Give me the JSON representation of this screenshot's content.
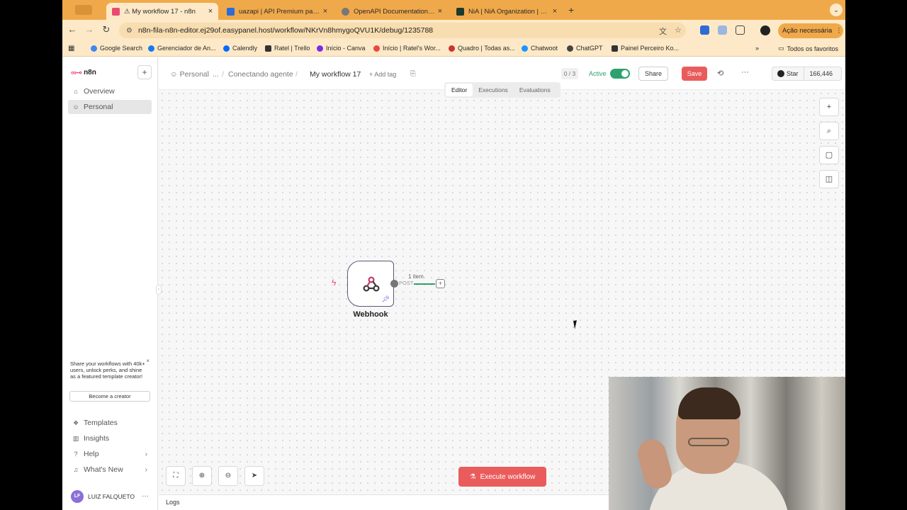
{
  "browser": {
    "tabs": [
      {
        "title": "⚠ My workflow 17 - n8n",
        "active": true
      },
      {
        "title": "uazapi | API Premium para W...",
        "active": false
      },
      {
        "title": "OpenAPI Documentation Gen...",
        "active": false
      },
      {
        "title": "NiA | NiA Organization | Supa...",
        "active": false
      }
    ],
    "new_tab": "+",
    "url": "n8n-fila-n8n-editor.ej29of.easypanel.host/workflow/NKrVn8hmygoQVU1K/debug/1235788",
    "update_button": "Ação necessária",
    "bookmarks": [
      "Google Search",
      "Gerenciador de An...",
      "Calendly",
      "Ratel | Trello",
      "Início - Canva",
      "Início | Ratel's Wor...",
      "Quadro | Todas as...",
      "Chatwoot",
      "ChatGPT",
      "Painel Perceiro Ko..."
    ],
    "all_bookmarks": "Todos os favoritos"
  },
  "sidebar": {
    "logo": "n8n",
    "items": [
      {
        "label": "Overview",
        "icon": "home-icon"
      },
      {
        "label": "Personal",
        "icon": "user-icon"
      }
    ],
    "promo": {
      "text": "Share your workflows with 40k+ users, unlock perks, and shine as a featured template creator!",
      "button": "Become a creator"
    },
    "bottom_items": [
      {
        "label": "Templates",
        "icon": "templates-icon"
      },
      {
        "label": "Insights",
        "icon": "insights-icon"
      },
      {
        "label": "Help",
        "icon": "help-icon"
      },
      {
        "label": "What's New",
        "icon": "bell-icon"
      }
    ],
    "user": {
      "initials": "LF",
      "name": "LUIZ FALQUETO"
    }
  },
  "header": {
    "breadcrumb": [
      "Personal",
      "...",
      "Conectando agente"
    ],
    "title": "My workflow 17",
    "add_tag": "+ Add tag",
    "counter": "0 / 3",
    "active_label": "Active",
    "share": "Share",
    "save": "Save",
    "github_star": "Star",
    "github_count": "166,446",
    "tabs": [
      "Editor",
      "Executions",
      "Evaluations"
    ]
  },
  "canvas": {
    "node": {
      "name": "Webhook"
    },
    "edge": {
      "items": "1 item",
      "method": "POST"
    },
    "execute_button": "Execute workflow",
    "logs": "Logs"
  },
  "colors": {
    "accent": "#ea5c5c",
    "active_green": "#2da26d",
    "browser_chrome": "#f0a94a"
  }
}
